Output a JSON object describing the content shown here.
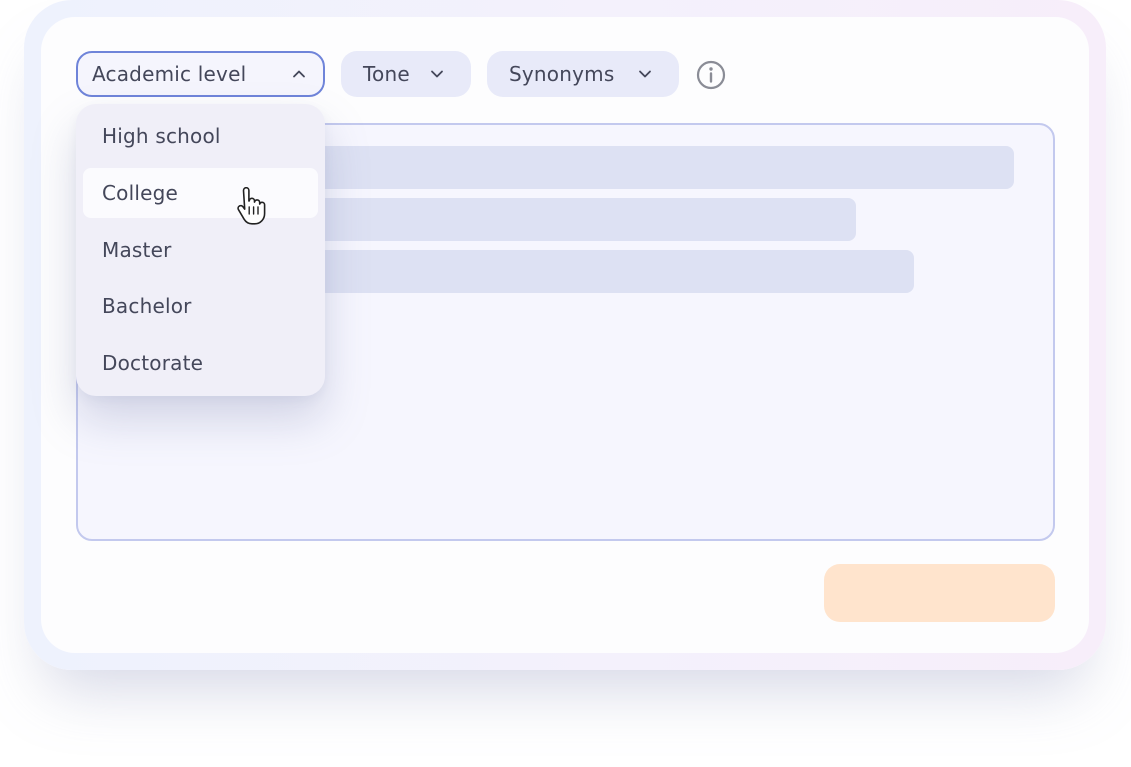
{
  "toolbar": {
    "academic_level_label": "Academic level",
    "tone_label": "Tone",
    "synonyms_label": "Synonyms",
    "info_icon": "info-circle-icon"
  },
  "dropdown": {
    "expanded": true,
    "hovered_item": "College",
    "items": [
      {
        "label": "High school"
      },
      {
        "label": "College"
      },
      {
        "label": "Master"
      },
      {
        "label": "Bachelor"
      },
      {
        "label": "Doctorate"
      }
    ]
  },
  "colors": {
    "accent_border": "#6f84d9",
    "chip_background": "#e8eaf9",
    "editor_border": "#c3c9ee",
    "skeleton": "#dde1f3",
    "submit_button": "#ffe4cd",
    "text": "#44475a"
  }
}
